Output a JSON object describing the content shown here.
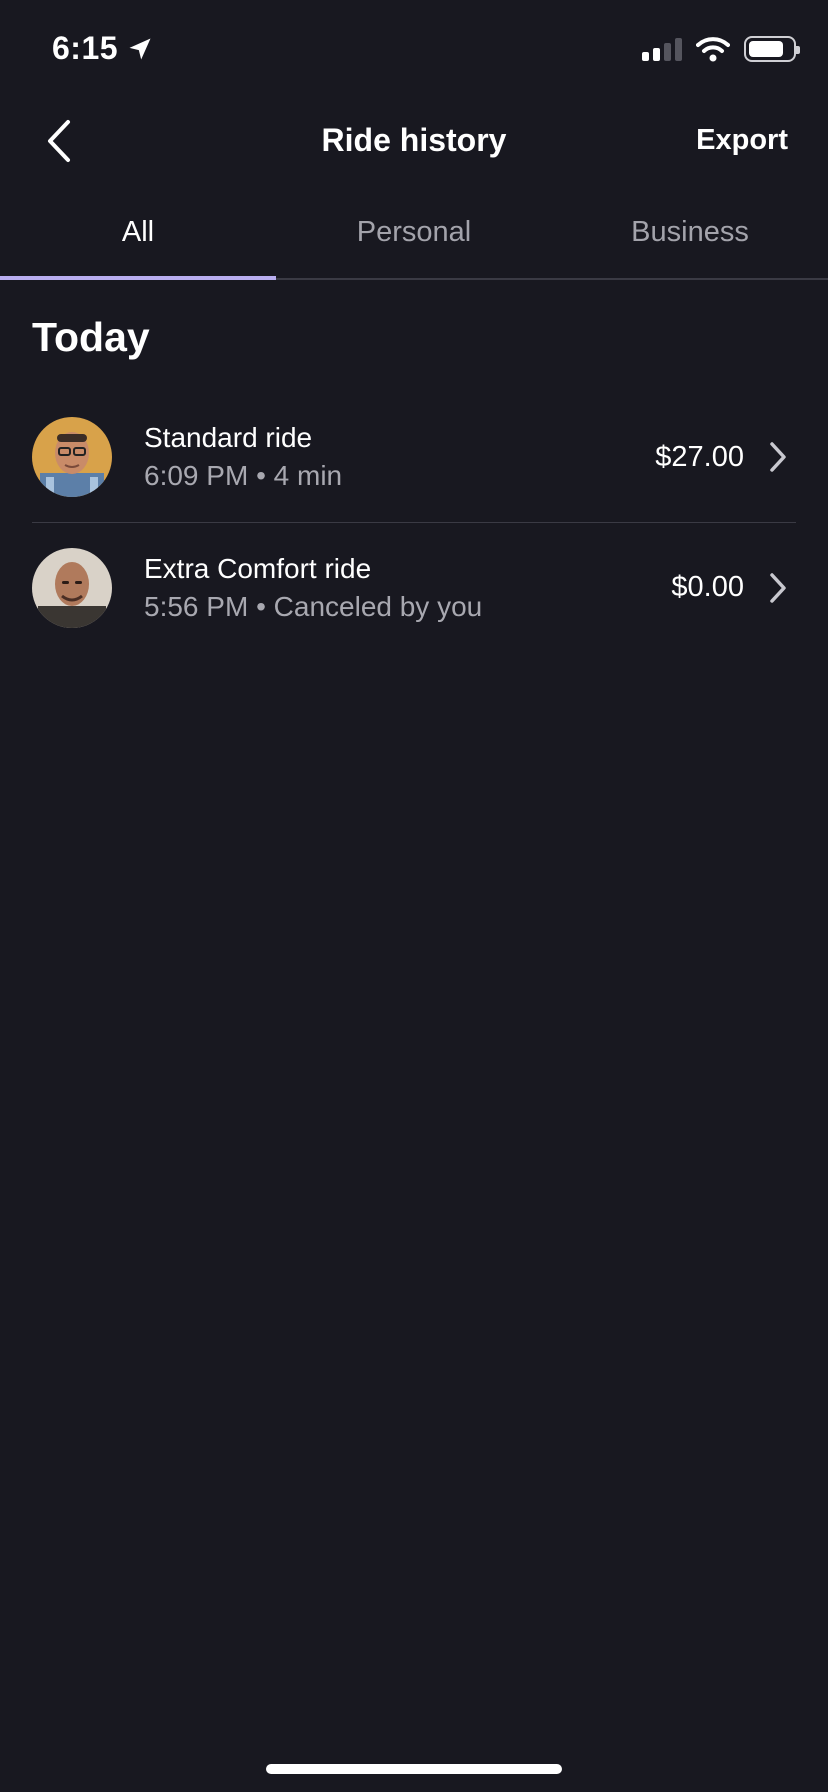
{
  "status_bar": {
    "time": "6:15"
  },
  "nav": {
    "title": "Ride history",
    "export_label": "Export"
  },
  "tabs": [
    {
      "label": "All",
      "active": true
    },
    {
      "label": "Personal",
      "active": false
    },
    {
      "label": "Business",
      "active": false
    }
  ],
  "section": {
    "title": "Today"
  },
  "rides": [
    {
      "title": "Standard ride",
      "time": "6:09 PM",
      "detail": "4 min",
      "price": "$27.00"
    },
    {
      "title": "Extra Comfort ride",
      "time": "5:56 PM",
      "detail": "Canceled by you",
      "price": "$0.00"
    }
  ],
  "colors": {
    "background": "#181820",
    "accent": "#b9aef0",
    "muted_text": "#a8a8b0"
  }
}
